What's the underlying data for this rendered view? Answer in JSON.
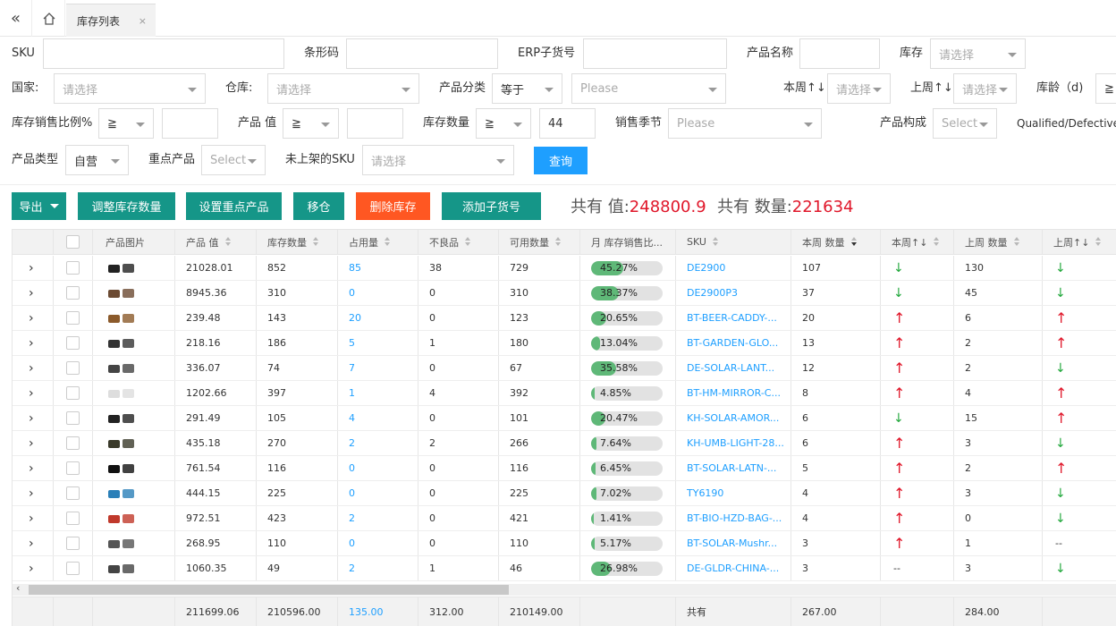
{
  "tabbar": {
    "tab_label": "库存列表",
    "close": "×"
  },
  "filters": {
    "sku_label": "SKU",
    "barcode_label": "条形码",
    "erp_label": "ERP子货号",
    "product_name_label": "产品名称",
    "stock_label": "库存",
    "stock_placeholder": "请选择",
    "country_label": "国家:",
    "country_placeholder": "请选择",
    "warehouse_label": "仓库:",
    "warehouse_placeholder": "请选择",
    "category_label": "产品分类",
    "category_op": "等于",
    "category_placeholder": "Please",
    "this_week_label": "本周↑↓",
    "this_week_placeholder": "请选择",
    "last_week_label": "上周↑↓",
    "last_week_placeholder": "请选择",
    "age_label": "库龄（d)",
    "age_op": "≧",
    "ratio_label": "库存销售比例%",
    "ratio_op": "≧",
    "value_label": "产品 值",
    "value_op": "≧",
    "qty_label": "库存数量",
    "qty_op": "≧",
    "qty_value": "44",
    "season_label": "销售季节",
    "season_placeholder": "Please",
    "composition_label": "产品构成",
    "composition_placeholder": "Select",
    "qualified_label": "Qualified/Defective",
    "type_label": "产品类型",
    "type_value": "自营",
    "key_label": "重点产品",
    "key_placeholder": "Select",
    "unlisted_label": "未上架的SKU",
    "unlisted_placeholder": "请选择",
    "query_button": "查询"
  },
  "toolbar": {
    "export": "导出",
    "adjust": "调整库存数量",
    "set_key": "设置重点产品",
    "move": "移仓",
    "delete": "删除库存",
    "add_sub": "添加子货号",
    "total_value_label": "共有 值:",
    "total_value": "248800.9",
    "total_qty_label": "共有 数量:",
    "total_qty": "221634"
  },
  "table": {
    "headers": [
      "产品图片",
      "产品 值",
      "库存数量",
      "占用量",
      "不良品",
      "可用数量",
      "月 库存销售比...",
      "SKU",
      "本周 数量",
      "本周↑↓",
      "上周 数量",
      "上周↑↓"
    ],
    "rows": [
      {
        "value": "21028.01",
        "stock": "852",
        "occupied": "85",
        "defective": "38",
        "available": "729",
        "ratio": "45.27%",
        "ratio_pct": 45.27,
        "sku": "DE2900",
        "week": "107",
        "week_trend": "down",
        "last": "130",
        "last_trend": "down"
      },
      {
        "value": "8945.36",
        "stock": "310",
        "occupied": "0",
        "defective": "0",
        "available": "310",
        "ratio": "38.37%",
        "ratio_pct": 38.37,
        "sku": "DE2900P3",
        "week": "37",
        "week_trend": "down",
        "last": "45",
        "last_trend": "down"
      },
      {
        "value": "239.48",
        "stock": "143",
        "occupied": "20",
        "defective": "0",
        "available": "123",
        "ratio": "20.65%",
        "ratio_pct": 20.65,
        "sku": "BT-BEER-CADDY-...",
        "week": "20",
        "week_trend": "up",
        "last": "6",
        "last_trend": "up"
      },
      {
        "value": "218.16",
        "stock": "186",
        "occupied": "5",
        "defective": "1",
        "available": "180",
        "ratio": "13.04%",
        "ratio_pct": 13.04,
        "sku": "BT-GARDEN-GLO...",
        "week": "13",
        "week_trend": "up",
        "last": "2",
        "last_trend": "up"
      },
      {
        "value": "336.07",
        "stock": "74",
        "occupied": "7",
        "defective": "0",
        "available": "67",
        "ratio": "35.58%",
        "ratio_pct": 35.58,
        "sku": "DE-SOLAR-LANT...",
        "week": "12",
        "week_trend": "up",
        "last": "2",
        "last_trend": "down"
      },
      {
        "value": "1202.66",
        "stock": "397",
        "occupied": "1",
        "defective": "4",
        "available": "392",
        "ratio": "4.85%",
        "ratio_pct": 4.85,
        "sku": "BT-HM-MIRROR-C...",
        "week": "8",
        "week_trend": "up",
        "last": "4",
        "last_trend": "up"
      },
      {
        "value": "291.49",
        "stock": "105",
        "occupied": "4",
        "defective": "0",
        "available": "101",
        "ratio": "20.47%",
        "ratio_pct": 20.47,
        "sku": "KH-SOLAR-AMOR...",
        "week": "6",
        "week_trend": "down",
        "last": "15",
        "last_trend": "up"
      },
      {
        "value": "435.18",
        "stock": "270",
        "occupied": "2",
        "defective": "2",
        "available": "266",
        "ratio": "7.64%",
        "ratio_pct": 7.64,
        "sku": "KH-UMB-LIGHT-28...",
        "week": "6",
        "week_trend": "up",
        "last": "3",
        "last_trend": "down"
      },
      {
        "value": "761.54",
        "stock": "116",
        "occupied": "0",
        "defective": "0",
        "available": "116",
        "ratio": "6.45%",
        "ratio_pct": 6.45,
        "sku": "BT-SOLAR-LATN-...",
        "week": "5",
        "week_trend": "up",
        "last": "2",
        "last_trend": "up"
      },
      {
        "value": "444.15",
        "stock": "225",
        "occupied": "0",
        "defective": "0",
        "available": "225",
        "ratio": "7.02%",
        "ratio_pct": 7.02,
        "sku": "TY6190",
        "week": "4",
        "week_trend": "up",
        "last": "3",
        "last_trend": "down"
      },
      {
        "value": "972.51",
        "stock": "423",
        "occupied": "2",
        "defective": "0",
        "available": "421",
        "ratio": "1.41%",
        "ratio_pct": 1.41,
        "sku": "BT-BIO-HZD-BAG-...",
        "week": "4",
        "week_trend": "up",
        "last": "0",
        "last_trend": "down"
      },
      {
        "value": "268.95",
        "stock": "110",
        "occupied": "0",
        "defective": "0",
        "available": "110",
        "ratio": "5.17%",
        "ratio_pct": 5.17,
        "sku": "BT-SOLAR-Mushr...",
        "week": "3",
        "week_trend": "up",
        "last": "1",
        "last_trend": "none"
      },
      {
        "value": "1060.35",
        "stock": "49",
        "occupied": "2",
        "defective": "1",
        "available": "46",
        "ratio": "26.98%",
        "ratio_pct": 26.98,
        "sku": "DE-GLDR-CHINA-...",
        "week": "3",
        "week_trend": "none",
        "last": "3",
        "last_trend": "down"
      }
    ],
    "footer": {
      "value": "211699.06",
      "stock": "210596.00",
      "occupied": "135.00",
      "defective": "312.00",
      "available": "210149.00",
      "label": "共有",
      "week": "267.00",
      "last": "284.00"
    }
  },
  "trend_glyphs": {
    "up": "↑",
    "down": "↓",
    "none": "--"
  },
  "colors": {
    "teal": "#159688",
    "orange": "#ff5722",
    "blue": "#1e9fff",
    "red": "#e0172a",
    "green": "#5fb878"
  }
}
